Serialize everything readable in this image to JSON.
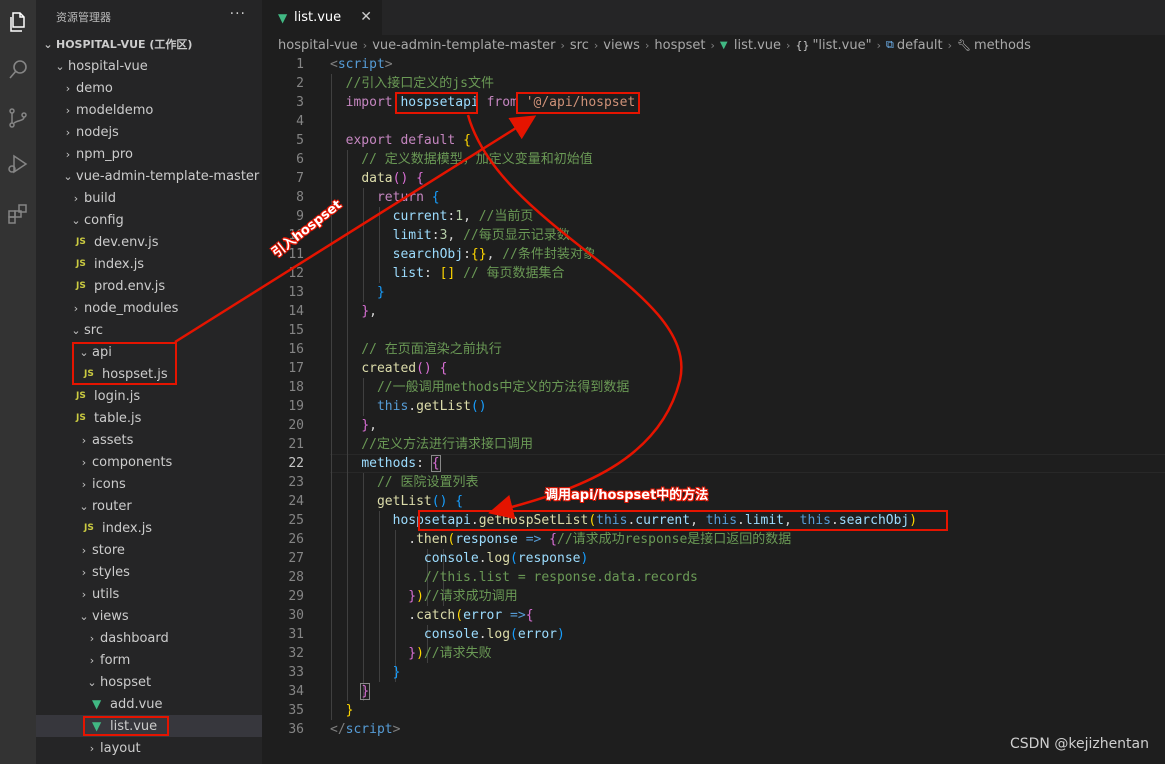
{
  "activity_bar": [
    "files-icon",
    "search-icon",
    "source-control-icon",
    "run-debug-icon",
    "extensions-icon"
  ],
  "sidebar": {
    "title": "资源管理器",
    "more": "···",
    "workspace": "HOSPITAL-VUE (工作区)",
    "tree": [
      {
        "label": "hospital-vue",
        "type": "folder-open"
      },
      {
        "label": "demo",
        "type": "folder"
      },
      {
        "label": "modeldemo",
        "type": "folder"
      },
      {
        "label": "nodejs",
        "type": "folder"
      },
      {
        "label": "npm_pro",
        "type": "folder"
      },
      {
        "label": "vue-admin-template-master",
        "type": "folder-open"
      },
      {
        "label": "build",
        "type": "folder"
      },
      {
        "label": "config",
        "type": "folder-open"
      },
      {
        "label": "dev.env.js",
        "type": "js"
      },
      {
        "label": "index.js",
        "type": "js"
      },
      {
        "label": "prod.env.js",
        "type": "js"
      },
      {
        "label": "node_modules",
        "type": "folder"
      },
      {
        "label": "src",
        "type": "folder-open"
      },
      {
        "label": "api",
        "type": "folder-open"
      },
      {
        "label": "hospset.js",
        "type": "js"
      },
      {
        "label": "login.js",
        "type": "js"
      },
      {
        "label": "table.js",
        "type": "js"
      },
      {
        "label": "assets",
        "type": "folder"
      },
      {
        "label": "components",
        "type": "folder"
      },
      {
        "label": "icons",
        "type": "folder"
      },
      {
        "label": "router",
        "type": "folder-open"
      },
      {
        "label": "index.js",
        "type": "js"
      },
      {
        "label": "store",
        "type": "folder"
      },
      {
        "label": "styles",
        "type": "folder"
      },
      {
        "label": "utils",
        "type": "folder"
      },
      {
        "label": "views",
        "type": "folder-open"
      },
      {
        "label": "dashboard",
        "type": "folder"
      },
      {
        "label": "form",
        "type": "folder"
      },
      {
        "label": "hospset",
        "type": "folder-open"
      },
      {
        "label": "add.vue",
        "type": "vue"
      },
      {
        "label": "list.vue",
        "type": "vue",
        "selected": true
      },
      {
        "label": "layout",
        "type": "folder"
      }
    ]
  },
  "tab": {
    "label": "list.vue",
    "close": "✕"
  },
  "breadcrumb": {
    "parts": [
      "hospital-vue",
      "vue-admin-template-master",
      "src",
      "views",
      "hospset"
    ],
    "file": "list.vue",
    "obj": "\"list.vue\"",
    "default": "default",
    "methods": "methods"
  },
  "editor": {
    "active_line": 22,
    "line_numbers": [
      "1",
      "2",
      "3",
      "4",
      "5",
      "6",
      "7",
      "8",
      "9",
      "10",
      "11",
      "12",
      "13",
      "14",
      "15",
      "16",
      "17",
      "18",
      "19",
      "20",
      "21",
      "22",
      "23",
      "24",
      "25",
      "26",
      "27",
      "28",
      "29",
      "30",
      "31",
      "32",
      "33",
      "34",
      "35",
      "36"
    ]
  },
  "annotations": {
    "import_label": "引入hospset",
    "call_label": "调用api/hospset中的方法",
    "color": "#e51400"
  },
  "watermark": "CSDN @kejizhentan"
}
